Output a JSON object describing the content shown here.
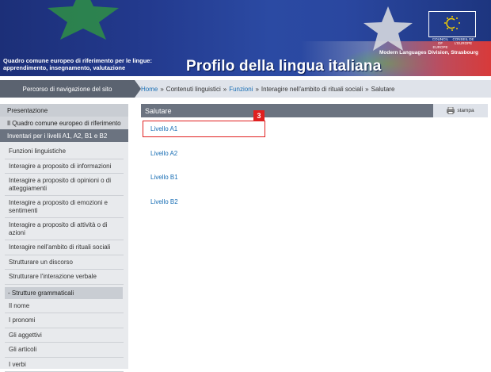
{
  "header": {
    "subtitle": "Quadro comune europeo di riferimento per le lingue: apprendimento, insegnamento, valutazione",
    "title": "Profilo della lingua italiana",
    "coe_left": "COUNCIL OF EUROPE",
    "coe_right": "CONSEIL DE L'EUROPE",
    "division": "Modern Languages Division, Strasbourg"
  },
  "navbar": {
    "label": "Percorso di navigazione del sito",
    "breadcrumb": {
      "home": "Home",
      "sep": "»",
      "contenuti": "Contenuti linguistici",
      "funzioni": "Funzioni",
      "interagire": "Interagire nell'ambito di rituali sociali",
      "current": "Salutare"
    }
  },
  "sidebar": {
    "top": [
      "Presentazione",
      "Il Quadro comune europeo di riferimento",
      "Inventari per i livelli A1, A2, B1 e B2"
    ],
    "items": [
      "Funzioni linguistiche",
      "Interagire a proposito di informazioni",
      "Interagire a proposito di opinioni o di atteggiamenti",
      "Interagire a proposito di emozioni e sentimenti",
      "Interagire a proposito di attività o di azioni",
      "Interagire nell'ambito di rituali sociali",
      "Strutturare un discorso",
      "Strutturare l'interazione verbale"
    ],
    "section": "- Strutture grammaticali",
    "sub_items": [
      "Il nome",
      "I pronomi",
      "Gli aggettivi",
      "Gli articoli",
      "I verbi"
    ]
  },
  "main": {
    "heading": "Salutare",
    "print_label": "stampa",
    "levels": [
      "Livello A1",
      "Livello A2",
      "Livello B1",
      "Livello B2"
    ],
    "badge": "3"
  },
  "colors": {
    "accent": "#1a6fb5",
    "highlight": "#e02020",
    "header": "#233a8e"
  }
}
